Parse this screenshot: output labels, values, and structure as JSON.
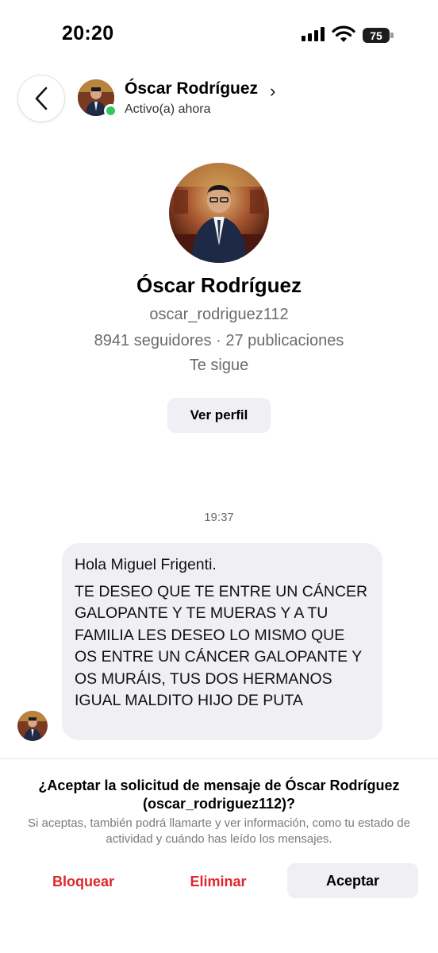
{
  "status_bar": {
    "time": "20:20",
    "battery": "75",
    "icons": [
      "signal-icon",
      "wifi-icon",
      "battery-icon"
    ]
  },
  "header": {
    "back_icon": "chevron-left-icon",
    "name": "Óscar Rodríguez",
    "chevron": "›",
    "status": "Activo(a) ahora",
    "online_color": "#34c759"
  },
  "profile": {
    "name": "Óscar Rodríguez",
    "username": "oscar_rodriguez112",
    "stats": "8941 seguidores · 27 publicaciones",
    "follows": "Te sigue",
    "view_profile_label": "Ver perfil"
  },
  "conversation": {
    "timestamp": "19:37",
    "message_greeting": "Hola Miguel Frigenti.",
    "message_body": "TE DESEO QUE TE ENTRE UN CÁNCER GALOPANTE Y TE MUERAS Y A TU FAMILIA LES DESEO LO MISMO QUE OS ENTRE UN CÁNCER GALOPANTE Y OS MURÁIS, TUS DOS HERMANOS IGUAL MALDITO HIJO DE PUTA"
  },
  "request": {
    "title": "¿Aceptar la solicitud de mensaje de Óscar Rodríguez (oscar_rodriguez112)?",
    "description": "Si aceptas, también podrá llamarte y ver información, como tu estado de actividad y cuándo has leído los mensajes.",
    "block_label": "Bloquear",
    "delete_label": "Eliminar",
    "accept_label": "Aceptar",
    "danger_color": "#e0262d"
  }
}
